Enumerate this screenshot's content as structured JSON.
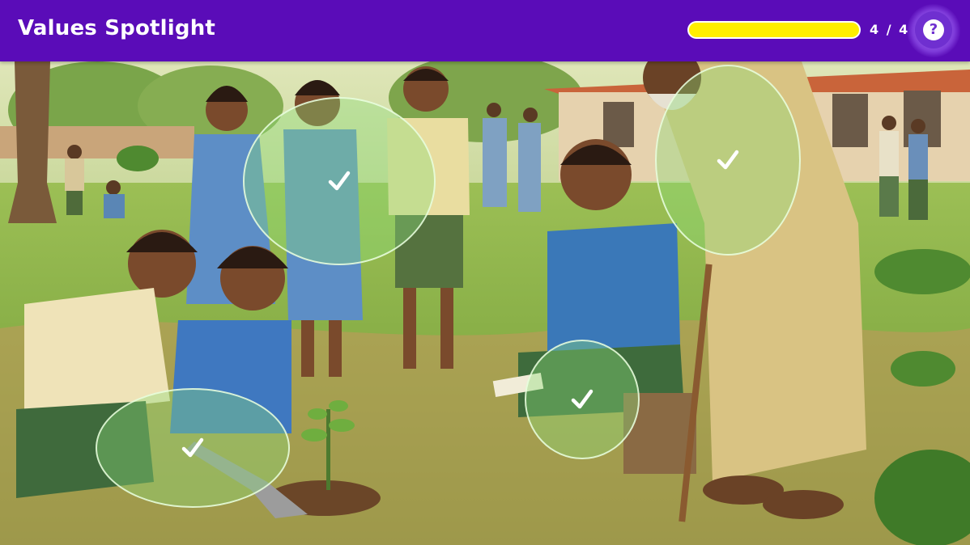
{
  "header": {
    "title": "Values Spotlight",
    "progress": {
      "found": 4,
      "total": 4,
      "fraction": 1.0,
      "label": "4 / 4"
    },
    "help_icon": "help-icon",
    "help_label": "?"
  },
  "colors": {
    "header_bg": "#5a0cb8",
    "progress_fill": "#ffee00",
    "hotspot_fill": "rgba(140,220,120,0.38)",
    "hotspot_border": "rgba(235,255,225,0.85)"
  },
  "hotspots": [
    {
      "id": "clapping-girl",
      "found": true,
      "icon": "check-icon"
    },
    {
      "id": "elder-shoulder",
      "found": true,
      "icon": "check-icon"
    },
    {
      "id": "planting-hands",
      "found": true,
      "icon": "check-icon"
    },
    {
      "id": "notebook-writing",
      "found": true,
      "icon": "check-icon"
    }
  ]
}
